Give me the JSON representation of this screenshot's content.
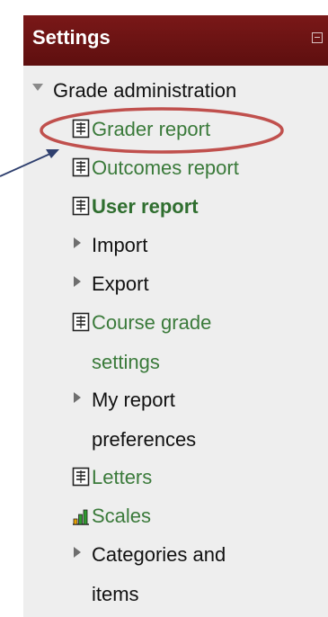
{
  "block": {
    "title": "Settings",
    "collapse_icon": "minus-box-icon"
  },
  "tree": {
    "parent": {
      "label": "Grade administration",
      "icon": "triangle-down-icon"
    },
    "items": [
      {
        "label": "Grader report",
        "type": "link",
        "icon": "document-icon"
      },
      {
        "label": "Outcomes report",
        "type": "link",
        "icon": "document-icon"
      },
      {
        "label": "User report",
        "type": "link-current",
        "icon": "document-icon"
      },
      {
        "label": "Import",
        "type": "branch",
        "icon": "triangle-right-icon"
      },
      {
        "label": "Export",
        "type": "branch",
        "icon": "triangle-right-icon"
      },
      {
        "label_line1": "Course grade",
        "label_line2": "settings",
        "type": "link",
        "icon": "document-icon"
      },
      {
        "label_line1": "My report",
        "label_line2": "preferences",
        "type": "branch",
        "icon": "triangle-right-icon"
      },
      {
        "label": "Letters",
        "type": "link",
        "icon": "document-icon"
      },
      {
        "label": "Scales",
        "type": "link",
        "icon": "bar-chart-icon"
      },
      {
        "label_line1": "Categories and",
        "label_line2": "items",
        "type": "branch",
        "icon": "triangle-right-icon"
      }
    ]
  },
  "colors": {
    "header_bg": "#6b1414",
    "block_bg": "#eeeeee",
    "link": "#3a7a3a",
    "annotation": "#c0504d"
  },
  "annotation": {
    "highlight_target": "Grader report",
    "shape": "ellipse-with-arrow"
  }
}
